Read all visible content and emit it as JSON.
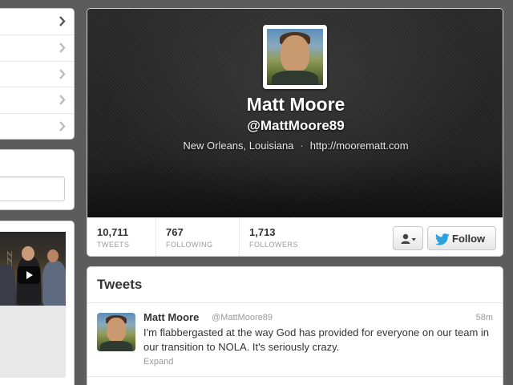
{
  "profile": {
    "name": "Matt Moore",
    "handle": "@MattMoore89",
    "location": "New Orleans, Louisiana",
    "separator": "·",
    "url": "http://moorematt.com"
  },
  "stats": {
    "tweets": {
      "value": "10,711",
      "label": "TWEETS"
    },
    "following": {
      "value": "767",
      "label": "FOLLOWING"
    },
    "followers": {
      "value": "1,713",
      "label": "FOLLOWERS"
    }
  },
  "actions": {
    "follow_label": "Follow",
    "user_menu_icon": "user-dropdown-icon"
  },
  "tweets_section": {
    "heading": "Tweets",
    "items": [
      {
        "name": "Matt Moore",
        "handle": "@MattMoore89",
        "time": "58m",
        "text": "I'm flabbergasted at the way God has provided for everyone on our team in our transition to NOLA. It's seriously crazy.",
        "expand": "Expand"
      }
    ]
  },
  "left_nav": {
    "chevron_icon": "chevron-right-icon"
  },
  "colors": {
    "background": "#5c5c5c",
    "header_bg": "#2b2b2b",
    "twitter_blue": "#2ba1df"
  }
}
